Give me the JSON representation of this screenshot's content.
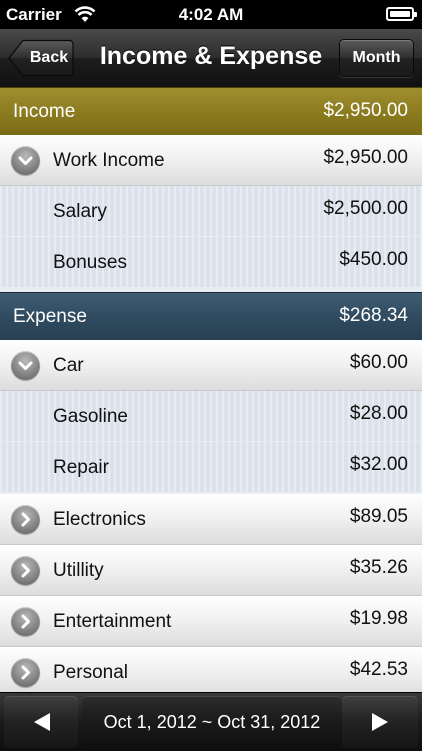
{
  "status": {
    "carrier": "Carrier",
    "time": "4:02 AM"
  },
  "nav": {
    "back_label": "Back",
    "title": "Income & Expense",
    "month_label": "Month"
  },
  "income": {
    "label": "Income",
    "total": "$2,950.00",
    "rows": [
      {
        "label": "Work Income",
        "amount": "$2,950.00"
      },
      {
        "label": "Salary",
        "amount": "$2,500.00"
      },
      {
        "label": "Bonuses",
        "amount": "$450.00"
      }
    ]
  },
  "expense": {
    "label": "Expense",
    "total": "$268.34",
    "rows": [
      {
        "label": "Car",
        "amount": "$60.00"
      },
      {
        "label": "Gasoline",
        "amount": "$28.00"
      },
      {
        "label": "Repair",
        "amount": "$32.00"
      },
      {
        "label": "Electronics",
        "amount": "$89.05"
      },
      {
        "label": "Utillity",
        "amount": "$35.26"
      },
      {
        "label": "Entertainment",
        "amount": "$19.98"
      },
      {
        "label": "Personal",
        "amount": "$42.53"
      }
    ]
  },
  "footer": {
    "date_range": "Oct 1, 2012 ~ Oct 31, 2012"
  },
  "colors": {
    "income_header": "#8a7a1e",
    "expense_header": "#2f4a5f"
  },
  "icons": [
    "wifi-icon",
    "battery-icon",
    "chevron-down-icon",
    "chevron-right-icon",
    "left-arrow-icon",
    "right-arrow-icon"
  ]
}
